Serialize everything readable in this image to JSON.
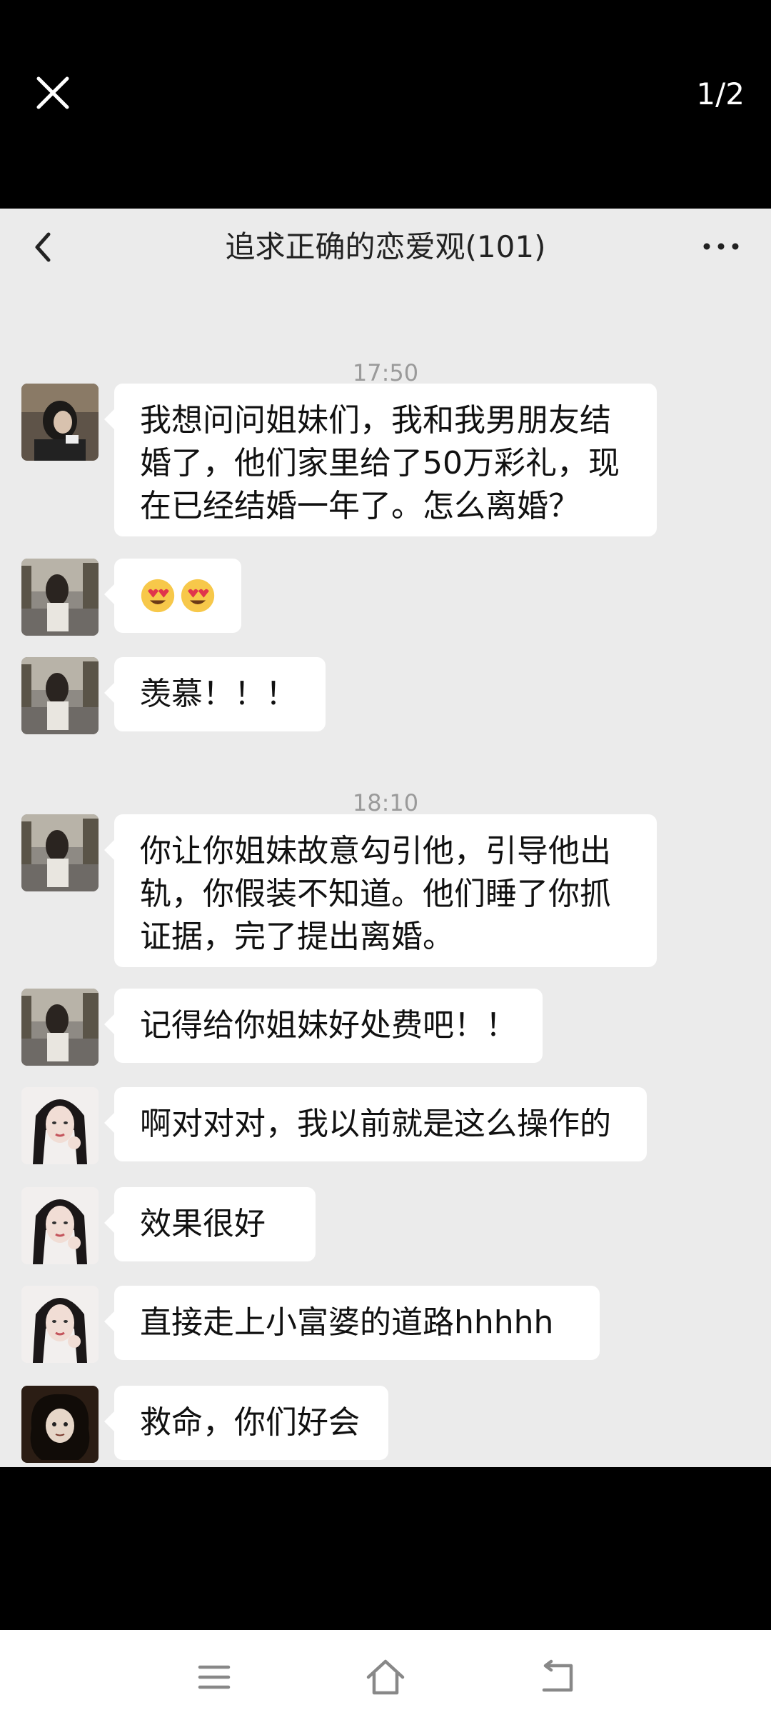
{
  "viewer": {
    "page_counter": "1/2"
  },
  "chat": {
    "title": "追求正确的恋爱观(101)",
    "timestamps": [
      "17:50",
      "18:10"
    ],
    "messages": [
      {
        "id": "m1",
        "avatar": "avatar-1",
        "text": "我想问问姐妹们，我和我男朋友结婚了，他们家里给了50万彩礼，现在已经结婚一年了。怎么离婚？"
      },
      {
        "id": "m2",
        "avatar": "avatar-2",
        "emoji": [
          "heart-eyes-emoji",
          "heart-eyes-emoji"
        ]
      },
      {
        "id": "m3",
        "avatar": "avatar-2",
        "text": "羡慕！！！"
      },
      {
        "id": "m4",
        "avatar": "avatar-2",
        "text": "你让你姐妹故意勾引他，引导他出轨，你假装不知道。他们睡了你抓证据，完了提出离婚。"
      },
      {
        "id": "m5",
        "avatar": "avatar-2",
        "text": "记得给你姐妹好处费吧！！"
      },
      {
        "id": "m6",
        "avatar": "avatar-3",
        "text": "啊对对对，我以前就是这么操作的"
      },
      {
        "id": "m7",
        "avatar": "avatar-3",
        "text": "效果很好"
      },
      {
        "id": "m8",
        "avatar": "avatar-3",
        "text": "直接走上小富婆的道路hhhhh"
      },
      {
        "id": "m9",
        "avatar": "avatar-4",
        "text": "救命，你们好会"
      }
    ]
  },
  "icons": {
    "close": "close-icon",
    "back": "back-arrow-icon",
    "more": "more-dots-icon",
    "nav": [
      "menu-icon",
      "home-icon",
      "back-nav-icon"
    ]
  },
  "colors": {
    "chat_bg": "#ebebeb",
    "bubble": "#ffffff",
    "viewer_bg": "#000000"
  }
}
